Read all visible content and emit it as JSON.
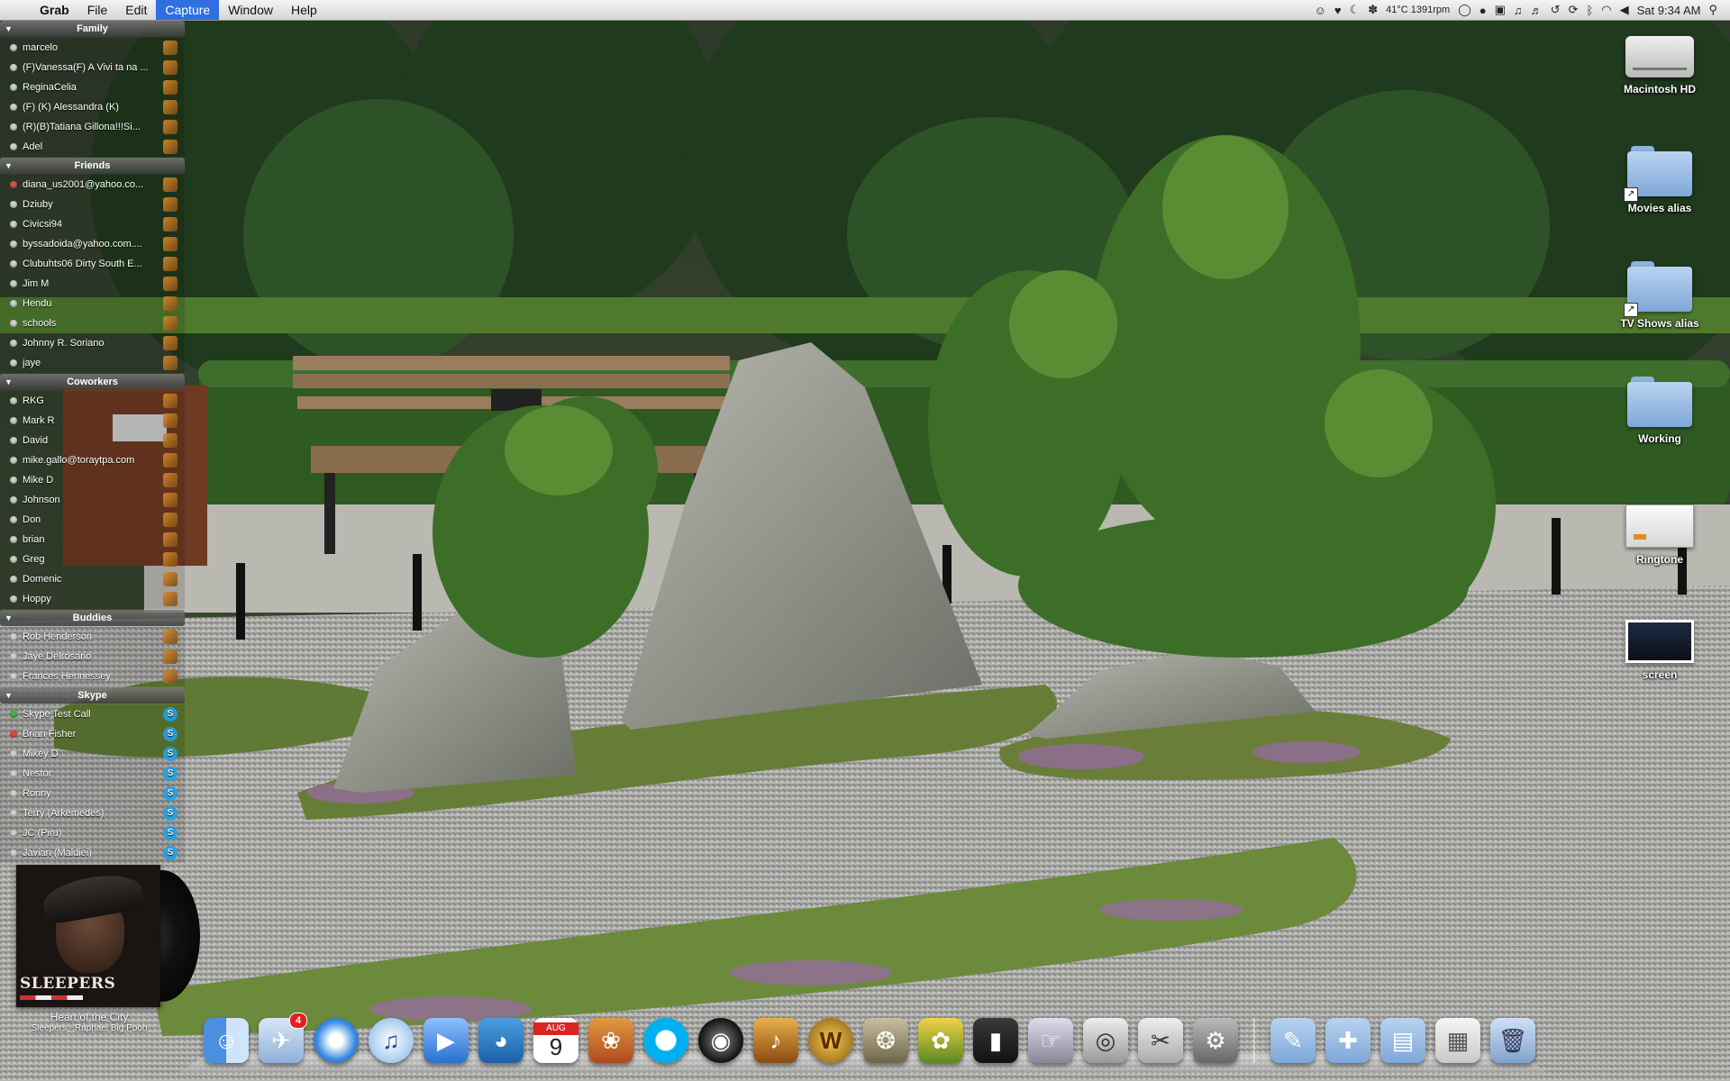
{
  "menubar": {
    "app_name": "Grab",
    "menus": [
      "File",
      "Edit",
      "Capture",
      "Window",
      "Help"
    ],
    "active_menu": "Capture",
    "temperature": "41°C 1391rpm",
    "clock": "Sat 9:34 AM"
  },
  "buddy_list": {
    "groups": [
      {
        "name": "Family",
        "buddies": [
          "marcelo",
          "(F)Vanessa(F) A Vivi ta na ...",
          "ReginaCelia",
          "(F) (K)  Alessandra  (K)",
          "(R)(B)Tatiana Gillona!!!Si...",
          "Adel"
        ]
      },
      {
        "name": "Friends",
        "buddies": [
          "diana_us2001@yahoo.co...",
          "Dziuby",
          "Civicsi94",
          "byssadoida@yahoo.com....",
          "Clubuhts06 Dirty South E...",
          "Jim M",
          "Hendu",
          "schools",
          "Johnny R. Soriano",
          "jaye"
        ]
      },
      {
        "name": "Coworkers",
        "buddies": [
          "RKG",
          "Mark R",
          "David",
          "mike.gallo@toraytpa.com",
          "Mike D",
          "Johnson",
          "Don",
          "brian",
          "Greg",
          "Domenic",
          "Hoppy"
        ]
      },
      {
        "name": "Buddies",
        "buddies": [
          "Rob Henderson",
          "Jaye Delrosario",
          "Frances Hennessey"
        ]
      },
      {
        "name": "Skype",
        "buddies": [
          "Skype Test Call",
          "Brian Fisher",
          "Mikey D",
          "Nestor",
          "Ronny",
          "Terry (Arkemedes)",
          "JC (Piru)",
          "Javian (Maldiei)"
        ]
      }
    ]
  },
  "now_playing": {
    "album_cover_text": "SLEEPERS",
    "track": "Heart of the City",
    "artist": "Sleepers - Raphael Big Pooh"
  },
  "desktop_icons": {
    "macintosh_hd": "Macintosh HD",
    "movies_alias": "Movies alias",
    "tv_shows_alias": "TV Shows alias",
    "working": "Working",
    "ringtone": "Ringtone",
    "screen": "screen"
  },
  "dock": {
    "mail_badge": "4",
    "calendar_date": "9",
    "calendar_month": "AUG"
  },
  "colors": {
    "menu_highlight": "#2f6fe0",
    "badge_red": "#e02020",
    "skype_blue": "#1aa3e8"
  }
}
